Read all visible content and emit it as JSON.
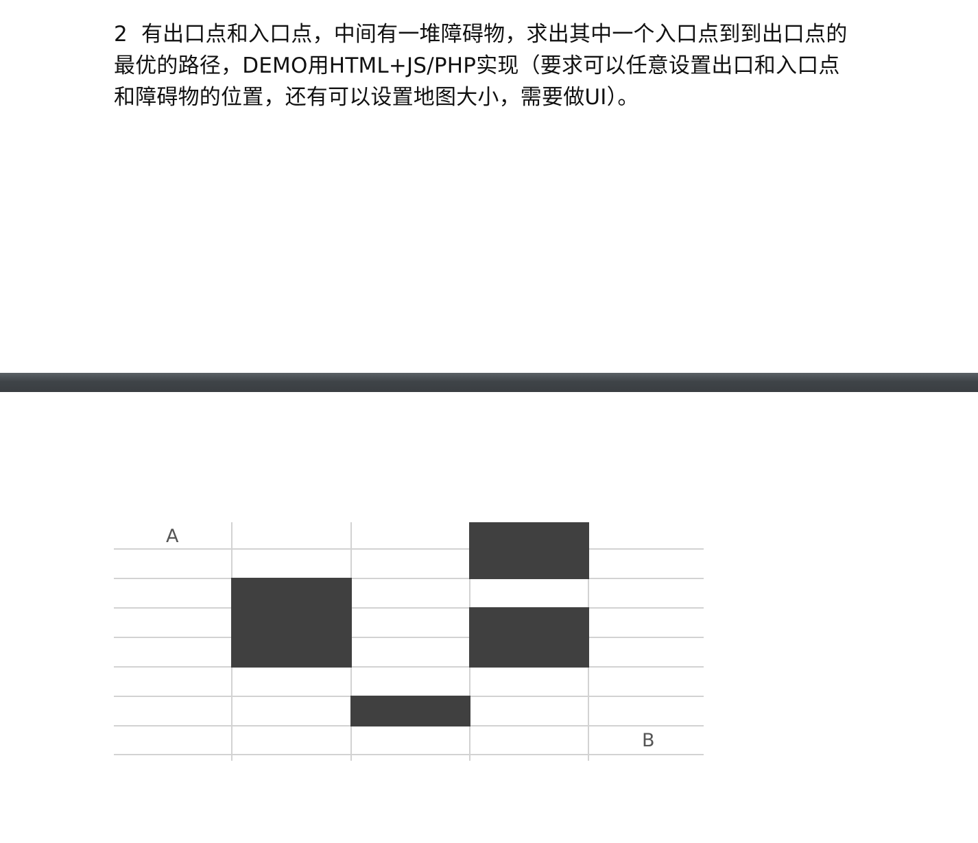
{
  "question": {
    "number": "2",
    "lines": [
      "有出口点和入口点，中间有一堆障碍物，求出其中一个入口点到到出口点的",
      "最优的路径，DEMO用HTML+JS/PHP实现（要求可以任意设置出口和入口点",
      "和障碍物的位置，还有可以设置地图大小，需要做UI）。"
    ]
  },
  "figure": {
    "point_a": "A",
    "point_b": "B",
    "colors": {
      "obstacle": "#404040",
      "grid_line": "#d2d2d2",
      "label": "#555555",
      "divider": "#3f4448"
    }
  }
}
